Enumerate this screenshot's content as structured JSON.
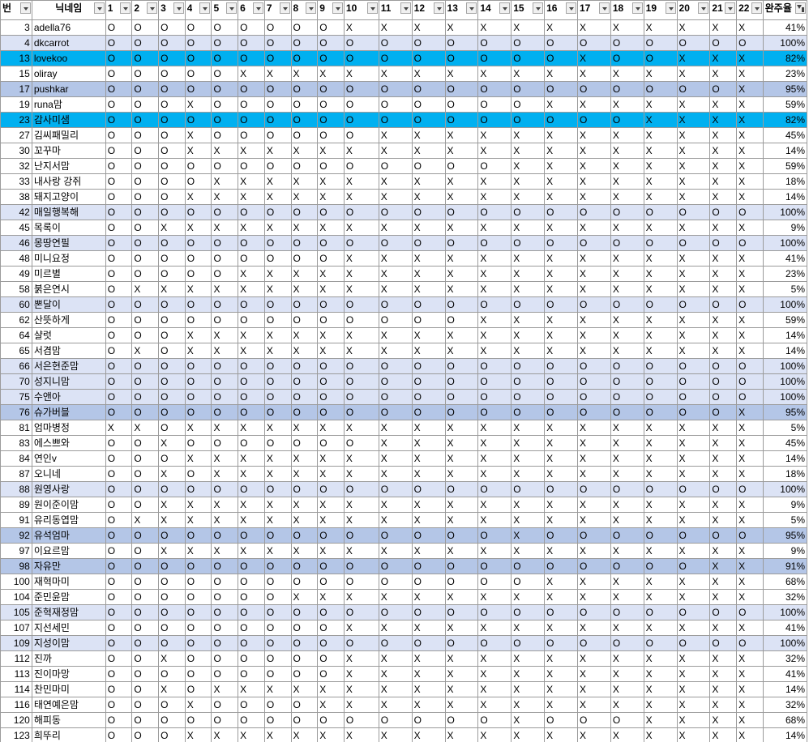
{
  "headers": [
    "번",
    "닉네임",
    "1",
    "2",
    "3",
    "4",
    "5",
    "6",
    "7",
    "8",
    "9",
    "10",
    "11",
    "12",
    "13",
    "14",
    "15",
    "16",
    "17",
    "18",
    "19",
    "20",
    "21",
    "22",
    "완주율"
  ],
  "rows": [
    {
      "n": "3",
      "name": "adella76",
      "m": "OOOOOOOOOXXXXXXXXXXXXX",
      "pct": "41%",
      "s": ""
    },
    {
      "n": "4",
      "name": "dkcarrot",
      "m": "OOOOOOOOOOOOOOOOOOOOOO",
      "pct": "100%",
      "s": "band"
    },
    {
      "n": "13",
      "name": "lovekoo",
      "m": "OOOOOOOOOOOOOOOOXOOXXX",
      "pct": "82%",
      "s": "sel"
    },
    {
      "n": "15",
      "name": "oliray",
      "m": "OOOOOXXXXXXXXXXXXXXXXX",
      "pct": "23%",
      "s": ""
    },
    {
      "n": "17",
      "name": "pushkar",
      "m": "OOOOOOOOOOOOOOOOOOOOOX",
      "pct": "95%",
      "s": "hl"
    },
    {
      "n": "19",
      "name": "runa맘",
      "m": "OOOXOOOOOOOOOOOXXXXXXX",
      "pct": "59%",
      "s": ""
    },
    {
      "n": "23",
      "name": "감사미샘",
      "m": "OOOOOOOOOOOOOOOOOOXXXX",
      "pct": "82%",
      "s": "sel"
    },
    {
      "n": "27",
      "name": "김씨패밀리",
      "m": "OOOXOOOOOOXXXXXXXXXXXX",
      "pct": "45%",
      "s": ""
    },
    {
      "n": "30",
      "name": "꼬꾸마",
      "m": "OOOXXXXXXXXXXXXXXXXXXX",
      "pct": "14%",
      "s": ""
    },
    {
      "n": "32",
      "name": "난지서맘",
      "m": "OOOOOOOOOOOOOOXXXXXXXX",
      "pct": "59%",
      "s": ""
    },
    {
      "n": "33",
      "name": "내사랑 강쥐",
      "m": "OOOOXXXXXXXXXXXXXXXXXX",
      "pct": "18%",
      "s": ""
    },
    {
      "n": "38",
      "name": "돼지고양이",
      "m": "OOOXXXXXXXXXXXXXXXXXXX",
      "pct": "14%",
      "s": ""
    },
    {
      "n": "42",
      "name": "매일행복해",
      "m": "OOOOOOOOOOOOOOOOOOOOOO",
      "pct": "100%",
      "s": "band"
    },
    {
      "n": "45",
      "name": "목록이",
      "m": "OOXXXXXXXXXXXXXXXXXXXX",
      "pct": "9%",
      "s": ""
    },
    {
      "n": "46",
      "name": "몽땅연필",
      "m": "OOOOOOOOOOOOOOOOOOOOOO",
      "pct": "100%",
      "s": "band"
    },
    {
      "n": "48",
      "name": "미니요정",
      "m": "OOOOOOOOOXXXXXXXXXXXXX",
      "pct": "41%",
      "s": ""
    },
    {
      "n": "49",
      "name": "미르별",
      "m": "OOOOOXXXXXXXXXXXXXXXXX",
      "pct": "23%",
      "s": ""
    },
    {
      "n": "58",
      "name": "붉은연시",
      "m": "OXXXXXXXXXXXXXXXXXXXXX",
      "pct": "5%",
      "s": ""
    },
    {
      "n": "60",
      "name": "뽄달이",
      "m": "OOOOOOOOOOOOOOOOOOOOOO",
      "pct": "100%",
      "s": "band"
    },
    {
      "n": "62",
      "name": "산뜻하게",
      "m": "OOOOOOOOOOOOOXXXXXXXXX",
      "pct": "59%",
      "s": ""
    },
    {
      "n": "64",
      "name": "샬럿",
      "m": "OOOXXXXXXXXXXXXXXXXXXX",
      "pct": "14%",
      "s": ""
    },
    {
      "n": "65",
      "name": "서겸맘",
      "m": "OXOXXXXXXXXXXXXXXXXXXX",
      "pct": "14%",
      "s": ""
    },
    {
      "n": "66",
      "name": "서은현준맘",
      "m": "OOOOOOOOOOOOOOOOOOOOOO",
      "pct": "100%",
      "s": "band"
    },
    {
      "n": "70",
      "name": "성지니맘",
      "m": "OOOOOOOOOOOOOOOOOOOOOO",
      "pct": "100%",
      "s": "band"
    },
    {
      "n": "75",
      "name": "수앤아",
      "m": "OOOOOOOOOOOOOOOOOOOOOO",
      "pct": "100%",
      "s": "band"
    },
    {
      "n": "76",
      "name": "슈가버블",
      "m": "OOOOOOOOOOOOOOOOOOOOOX",
      "pct": "95%",
      "s": "hl"
    },
    {
      "n": "81",
      "name": "엄마병정",
      "m": "XXOXXXXXXXXXXXXXXXXXXX",
      "pct": "5%",
      "s": ""
    },
    {
      "n": "83",
      "name": "에스쁘와",
      "m": "OOXOOOOOOOXXXXXXXXXXXX",
      "pct": "45%",
      "s": ""
    },
    {
      "n": "84",
      "name": "연인v",
      "m": "OOOXXXXXXXXXXXXXXXXXXX",
      "pct": "14%",
      "s": ""
    },
    {
      "n": "87",
      "name": "오니네",
      "m": "OOXOXXXXXXXXXXXXXXXXXX",
      "pct": "18%",
      "s": ""
    },
    {
      "n": "88",
      "name": "원영사랑",
      "m": "OOOOOOOOOOOOOOOOOOOOOO",
      "pct": "100%",
      "s": "band"
    },
    {
      "n": "89",
      "name": "원이준이맘",
      "m": "OOXXXXXXXXXXXXXXXXXXXX",
      "pct": "9%",
      "s": ""
    },
    {
      "n": "91",
      "name": "유리동엽맘",
      "m": "OXXXXXXXXXXXXXXXXXXXXX",
      "pct": "5%",
      "s": ""
    },
    {
      "n": "92",
      "name": "유석엄마",
      "m": "OOOOOOOOOOOOOOXOOOOOOO",
      "pct": "95%",
      "s": "hl"
    },
    {
      "n": "97",
      "name": "이요르맘",
      "m": "OOXXXXXXXXXXXXXXXXXXXX",
      "pct": "9%",
      "s": ""
    },
    {
      "n": "98",
      "name": "자유만",
      "m": "OOOOOOOOOOOOOOOOOOOOXX",
      "pct": "91%",
      "s": "hl"
    },
    {
      "n": "100",
      "name": "재혁마미",
      "m": "OOOOOOOOOOOOOOOXXXXXXX",
      "pct": "68%",
      "s": ""
    },
    {
      "n": "104",
      "name": "준민윤맘",
      "m": "OOOOOOOXXXXXXXXXXXXXXX",
      "pct": "32%",
      "s": ""
    },
    {
      "n": "105",
      "name": "준혁재정맘",
      "m": "OOOOOOOOOOOOOOOOOOOOOO",
      "pct": "100%",
      "s": "band"
    },
    {
      "n": "107",
      "name": "지선세민",
      "m": "OOOOOOOOOXXXXXXXXXXXXX",
      "pct": "41%",
      "s": ""
    },
    {
      "n": "109",
      "name": "지성이맘",
      "m": "OOOOOOOOOOOOOOOOOOOOOO",
      "pct": "100%",
      "s": "band"
    },
    {
      "n": "112",
      "name": "진까",
      "m": "OOXOOOOOOXXXXXXXXXXXXX",
      "pct": "32%",
      "s": ""
    },
    {
      "n": "113",
      "name": "진이마망",
      "m": "OOOOOOOOOXXXXXXXXXXXXX",
      "pct": "41%",
      "s": ""
    },
    {
      "n": "114",
      "name": "찬민마미",
      "m": "OOXOXXXXXXXXXXXXXXXXXX",
      "pct": "14%",
      "s": ""
    },
    {
      "n": "116",
      "name": "태연예은맘",
      "m": "OOOXOOOOXXXXXXXXXXXXXX",
      "pct": "32%",
      "s": ""
    },
    {
      "n": "120",
      "name": "해피동",
      "m": "OOOOOOOOOOOOOOXOOOXXXX",
      "pct": "68%",
      "s": ""
    },
    {
      "n": "123",
      "name": "희뚜리",
      "m": "OOOXXXXXXXXXXXXXXXXXXX",
      "pct": "14%",
      "s": ""
    }
  ]
}
